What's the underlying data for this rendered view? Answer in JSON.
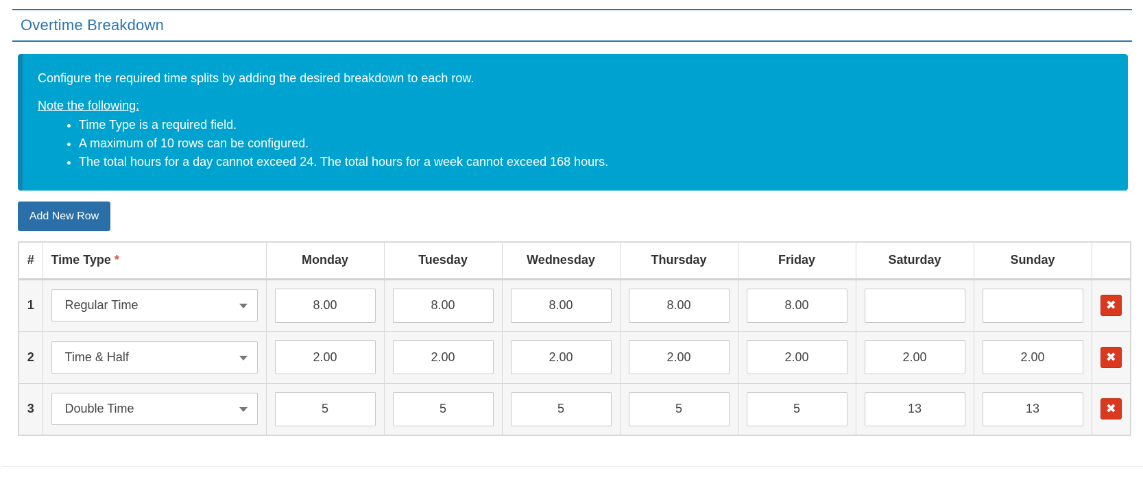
{
  "panel": {
    "title": "Overtime Breakdown"
  },
  "info": {
    "intro": "Configure the required time splits by adding the desired breakdown to each row.",
    "note_heading": "Note the following:",
    "bullets": [
      "Time Type is a required field.",
      "A maximum of 10 rows can be configured.",
      "The total hours for a day cannot exceed 24. The total hours for a week cannot exceed 168 hours."
    ]
  },
  "toolbar": {
    "add_row_label": "Add New Row"
  },
  "table": {
    "headers": {
      "num": "#",
      "time_type": "Time Type",
      "required_mark": "*",
      "days": [
        "Monday",
        "Tuesday",
        "Wednesday",
        "Thursday",
        "Friday",
        "Saturday",
        "Sunday"
      ]
    },
    "rows": [
      {
        "num": "1",
        "time_type": "Regular Time",
        "hours": [
          "8.00",
          "8.00",
          "8.00",
          "8.00",
          "8.00",
          "",
          ""
        ]
      },
      {
        "num": "2",
        "time_type": "Time & Half",
        "hours": [
          "2.00",
          "2.00",
          "2.00",
          "2.00",
          "2.00",
          "2.00",
          "2.00"
        ]
      },
      {
        "num": "3",
        "time_type": "Double Time",
        "hours": [
          "5",
          "5",
          "5",
          "5",
          "5",
          "13",
          "13"
        ]
      }
    ],
    "delete_icon": "close-icon"
  },
  "colors": {
    "brand": "#2a75ad",
    "info_bg": "#00a2cf",
    "button_bg": "#2a6fa8",
    "delete_bg": "#d9391e",
    "required": "#d9534f"
  }
}
